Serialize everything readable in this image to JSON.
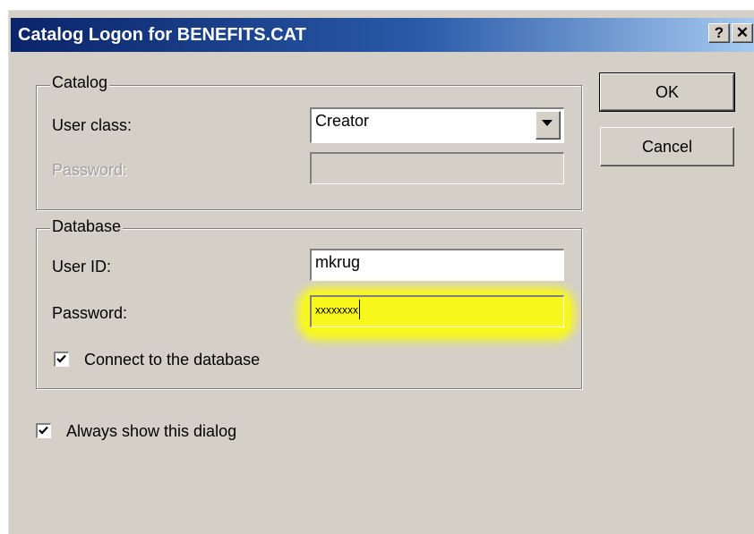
{
  "window": {
    "title": "Catalog Logon for BENEFITS.CAT",
    "help_label": "?",
    "close_label": "✕"
  },
  "catalog": {
    "legend": "Catalog",
    "user_class_label": "User class:",
    "user_class_value": "Creator",
    "password_label": "Password:",
    "password_value": ""
  },
  "database": {
    "legend": "Database",
    "user_id_label": "User ID:",
    "user_id_value": "mkrug",
    "password_label": "Password:",
    "password_value": "xxxxxxxx",
    "connect_label": "Connect to the database",
    "connect_checked": true
  },
  "options": {
    "always_show_label": "Always show this dialog",
    "always_show_checked": true
  },
  "buttons": {
    "ok": "OK",
    "cancel": "Cancel"
  },
  "colors": {
    "face": "#d4d0c8",
    "title_start": "#0a246a",
    "title_end": "#a6caf0",
    "highlight": "#ffff00"
  },
  "icons": {
    "dropdown": "chevron-down-icon",
    "check": "check-icon"
  }
}
